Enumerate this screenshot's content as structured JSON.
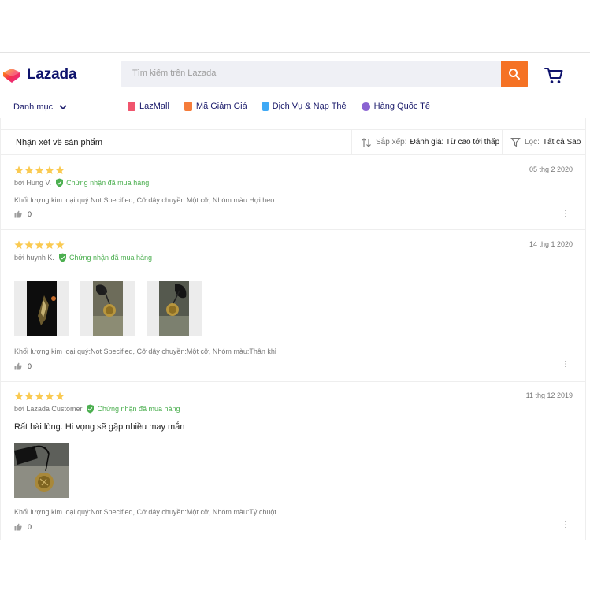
{
  "header": {
    "logo_text": "Lazada",
    "search_placeholder": "Tìm kiếm trên Lazada",
    "brand_color": "#f57224"
  },
  "nav": {
    "category_label": "Danh mục",
    "links": [
      {
        "label": "LazMall",
        "icon": "lazmall-icon",
        "color": "#f0556d"
      },
      {
        "label": "Mã Giảm Giá",
        "icon": "voucher-icon",
        "color": "#f57c3a"
      },
      {
        "label": "Dịch Vụ & Nạp Thẻ",
        "icon": "phone-icon",
        "color": "#3fa9f5"
      },
      {
        "label": "Hàng Quốc Tế",
        "icon": "global-icon",
        "color": "#8a63d2"
      }
    ]
  },
  "reviews_panel": {
    "title": "Nhận xét về sản phẩm",
    "sort_label": "Sắp xếp:",
    "sort_value": "Đánh giá: Từ cao tới thấp",
    "filter_label": "Lọc:",
    "filter_value": "Tất cả Sao"
  },
  "reviews": [
    {
      "rating": 5,
      "date": "05 thg 2 2020",
      "author": "bởi Hung V.",
      "verified": "Chứng nhận đã mua hàng",
      "text": "",
      "photos": [],
      "sku": "Khối lượng kim loại quý:Not Specified, Cỡ dây chuyền:Một cỡ, Nhóm màu:Hợi heo",
      "likes": "0"
    },
    {
      "rating": 5,
      "date": "14 thg 1 2020",
      "author": "bởi huynh K.",
      "verified": "Chứng nhận đã mua hàng",
      "text": "",
      "photos": [
        "review-photo-1",
        "review-photo-2",
        "review-photo-3"
      ],
      "sku": "Khối lượng kim loại quý:Not Specified, Cỡ dây chuyền:Một cỡ, Nhóm màu:Thân khỉ",
      "likes": "0"
    },
    {
      "rating": 5,
      "date": "11 thg 12 2019",
      "author": "bởi Lazada Customer",
      "verified": "Chứng nhận đã mua hàng",
      "text": "Rất hài lòng. Hi vọng sẽ gặp nhiều may mắn",
      "photos": [
        "review-photo-1"
      ],
      "sku": "Khối lượng kim loại quý:Not Specified, Cỡ dây chuyền:Một cỡ, Nhóm màu:Tý chuột",
      "likes": "0"
    }
  ],
  "colors": {
    "star": "#faca51",
    "verified": "#4caf50"
  }
}
